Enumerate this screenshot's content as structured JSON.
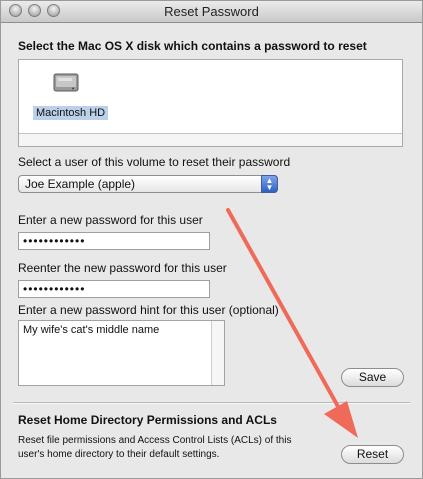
{
  "window": {
    "title": "Reset Password"
  },
  "disk_section": {
    "heading": "Select the Mac OS X disk which contains a password to reset",
    "disks": [
      {
        "name": "Macintosh HD",
        "icon": "hard-drive-icon"
      }
    ]
  },
  "user_section": {
    "label": "Select a user of this volume to reset their password",
    "selected_user": "Joe Example (apple)"
  },
  "password": {
    "new_label": "Enter a new password for this user",
    "new_value": "••••••••••••",
    "reenter_label": "Reenter the new password for this user",
    "reenter_value": "••••••••••••",
    "hint_label": "Enter a new password hint for this user (optional)",
    "hint_value": "My wife's cat's middle name",
    "save_label": "Save"
  },
  "acl_section": {
    "heading": "Reset Home Directory Permissions and ACLs",
    "description": "Reset file permissions and Access Control Lists (ACLs) of this user's home directory to their default settings.",
    "reset_label": "Reset"
  },
  "colors": {
    "annotation_arrow": "#f06a5a",
    "selection": "#bcd0ea",
    "popup_accent": "#3a6fd0"
  }
}
